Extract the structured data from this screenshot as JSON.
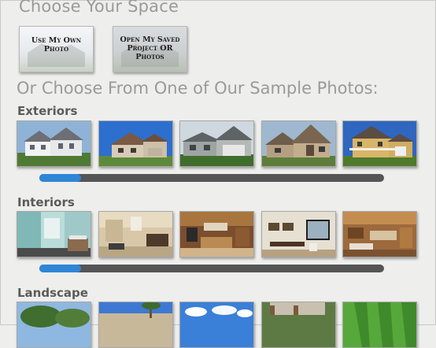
{
  "header": {
    "title": "Choose Your Space",
    "use_own_photo": "Use My Own Photo",
    "open_saved": "Open My Saved Project OR Photos",
    "sample_heading": "Or Choose From One of Our Sample Photos:"
  },
  "sections": {
    "exteriors": {
      "label": "Exteriors",
      "thumbs": [
        "two-story-white-house-photo",
        "blue-sky-house-photo",
        "gray-ranch-house-photo",
        "stone-house-photo",
        "yellow-victorian-house-photo"
      ],
      "scroll_fraction": 0.12
    },
    "interiors": {
      "label": "Interiors",
      "thumbs": [
        "bathroom-photo",
        "beige-bathroom-photo",
        "kitchen-photo",
        "dining-room-photo",
        "living-kitchen-photo"
      ],
      "scroll_fraction": 0.12
    },
    "landscape": {
      "label": "Landscape",
      "thumbs": [
        "tree-landscape-photo",
        "palm-house-photo",
        "sky-clouds-photo",
        "yard-photo",
        "lawn-stripes-photo"
      ]
    }
  },
  "colors": {
    "scroll_fill": "#2f86d6",
    "scroll_track": "#555555",
    "background": "#eeeeec"
  }
}
